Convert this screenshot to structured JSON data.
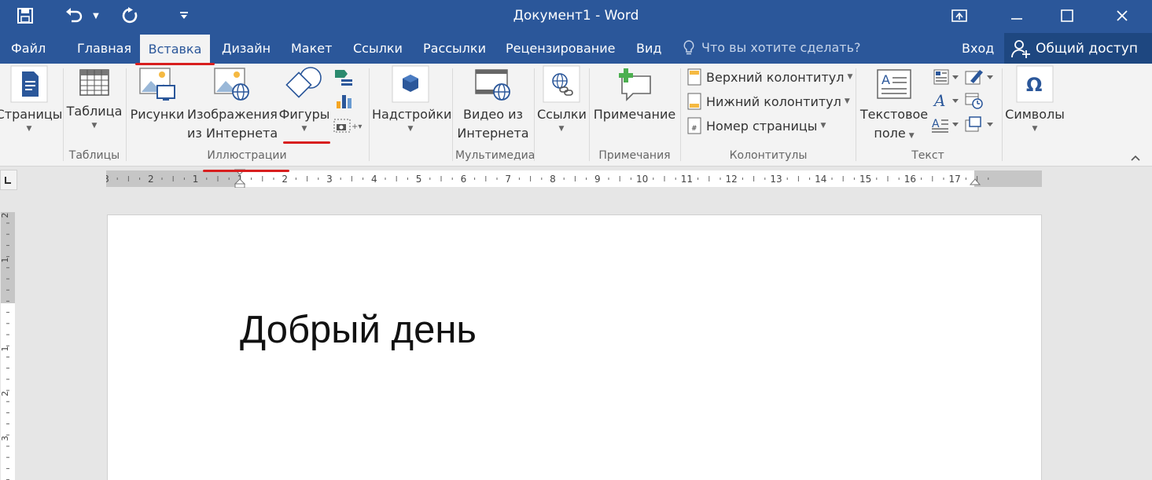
{
  "window": {
    "title": "Документ1 - Word"
  },
  "tabs": [
    {
      "label": "Файл"
    },
    {
      "label": "Главная"
    },
    {
      "label": "Вставка"
    },
    {
      "label": "Дизайн"
    },
    {
      "label": "Макет"
    },
    {
      "label": "Ссылки"
    },
    {
      "label": "Рассылки"
    },
    {
      "label": "Рецензирование"
    },
    {
      "label": "Вид"
    }
  ],
  "tell_me": {
    "placeholder": "Что вы хотите сделать?"
  },
  "signin": {
    "label": "Вход"
  },
  "share": {
    "label": "Общий доступ"
  },
  "ribbon": {
    "pages": {
      "label": "Страницы"
    },
    "table": {
      "label": "Таблица",
      "group": "Таблицы"
    },
    "pictures": {
      "label": "Рисунки"
    },
    "online_pictures": {
      "line1": "Изображения",
      "line2": "из Интернета"
    },
    "shapes": {
      "label": "Фигуры"
    },
    "illustrations_group": "Иллюстрации",
    "addins": {
      "label": "Надстройки"
    },
    "online_video": {
      "line1": "Видео из",
      "line2": "Интернета",
      "group": "Мультимедиа"
    },
    "links": {
      "label": "Ссылки"
    },
    "comment": {
      "label": "Примечание",
      "group": "Примечания"
    },
    "header": {
      "label": "Верхний колонтитул"
    },
    "footer": {
      "label": "Нижний колонтитул"
    },
    "page_number": {
      "label": "Номер страницы"
    },
    "header_footer_group": "Колонтитулы",
    "textbox": {
      "line1": "Текстовое",
      "line2": "поле"
    },
    "text_group": "Текст",
    "symbols": {
      "label": "Символы"
    }
  },
  "ruler": {
    "ticks": [
      "3",
      "2",
      "1",
      "1",
      "2",
      "3",
      "4",
      "5",
      "6",
      "7",
      "8",
      "9",
      "10",
      "11",
      "12",
      "13",
      "14",
      "15",
      "16",
      "17"
    ],
    "vticks": [
      "2",
      "1",
      "1",
      "2",
      "3"
    ]
  },
  "document": {
    "text": "Добрый день"
  },
  "colors": {
    "brand": "#2b579a",
    "annotation": "#d81e1e"
  }
}
